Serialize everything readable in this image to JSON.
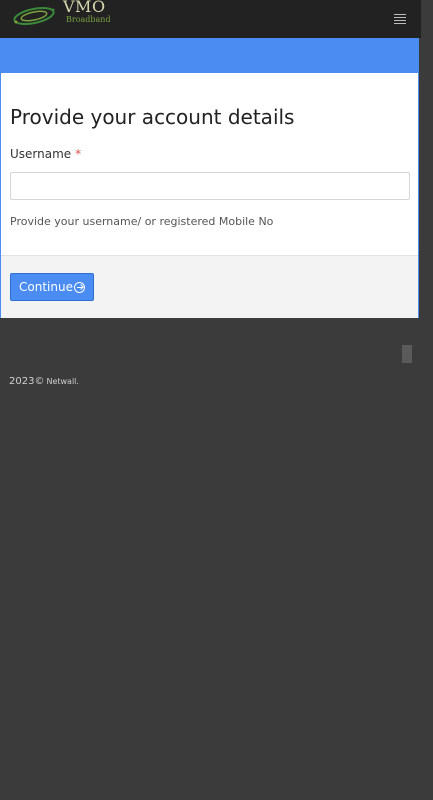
{
  "brand": {
    "name": "VMO",
    "tagline": "Broadband",
    "colors": {
      "text": "#d8d8b0",
      "tagline": "#7aa040",
      "swoosh": "#3a8a3a"
    }
  },
  "navbar": {
    "menu_icon": "hamburger-icon"
  },
  "form": {
    "title": "Provide your account details",
    "username_label": "Username",
    "required_marker": "*",
    "username_value": "",
    "username_placeholder": "",
    "help_text": "Provide your username/ or registered Mobile No",
    "continue_label": "Continue",
    "continue_icon": "arrow-circle-right-icon"
  },
  "footer": {
    "copyright": "2023©",
    "company": "Netwall."
  },
  "colors": {
    "accent": "#4a8cf2",
    "background": "#3b3b3b",
    "navbar": "#222222",
    "required": "#d9534f"
  }
}
